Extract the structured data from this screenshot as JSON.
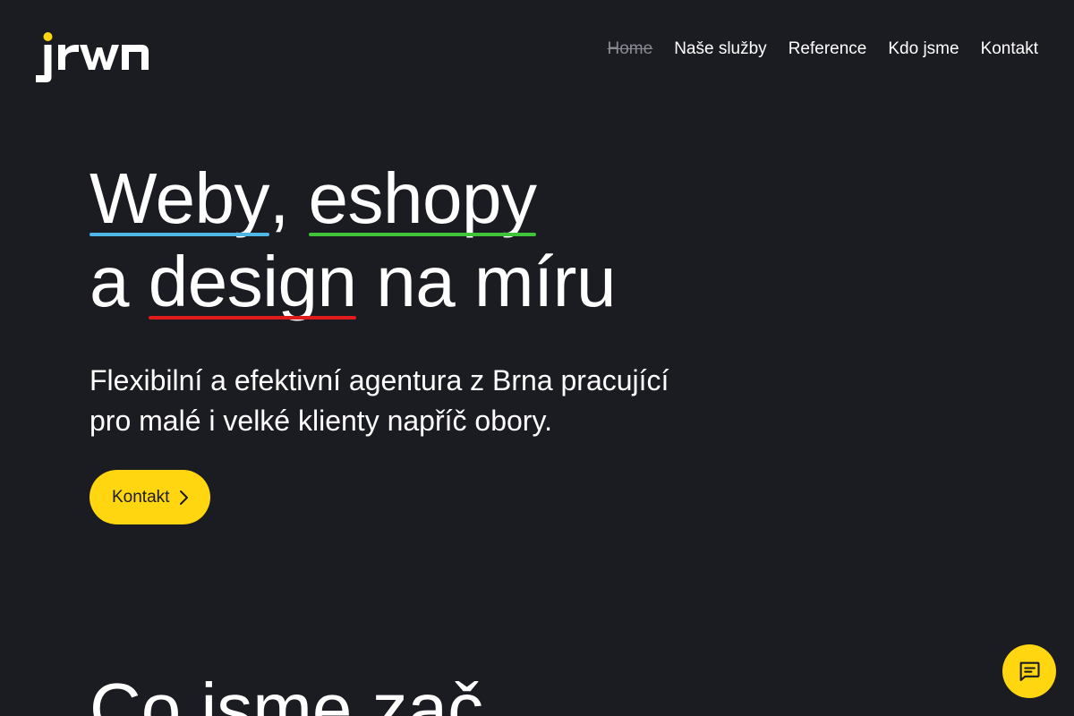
{
  "colors": {
    "background": "#1b1b22",
    "accent": "#ffd60f",
    "underline_blue": "#4fb7e6",
    "underline_green": "#3fc43a",
    "underline_red": "#e01b1b"
  },
  "logo": {
    "text": "jrwn",
    "icon": "jrwn-logo"
  },
  "nav": {
    "items": [
      {
        "label": "Home",
        "current": true
      },
      {
        "label": "Naše služby"
      },
      {
        "label": "Reference"
      },
      {
        "label": "Kdo jsme"
      },
      {
        "label": "Kontakt"
      }
    ]
  },
  "hero": {
    "word1": "Weby",
    "comma": ",",
    "word2": "eshopy",
    "prefix2": "a",
    "word3": "design",
    "suffix2": "na míru",
    "subtitle_line1": "Flexibilní a efektivní agentura z Brna pracující",
    "subtitle_line2": "pro malé i velké klienty napříč obory.",
    "cta_label": "Kontakt",
    "cta_icon": "chevron-right-icon"
  },
  "section": {
    "title": "Co jsme zač"
  },
  "chat": {
    "icon": "chat-bubble-icon"
  }
}
